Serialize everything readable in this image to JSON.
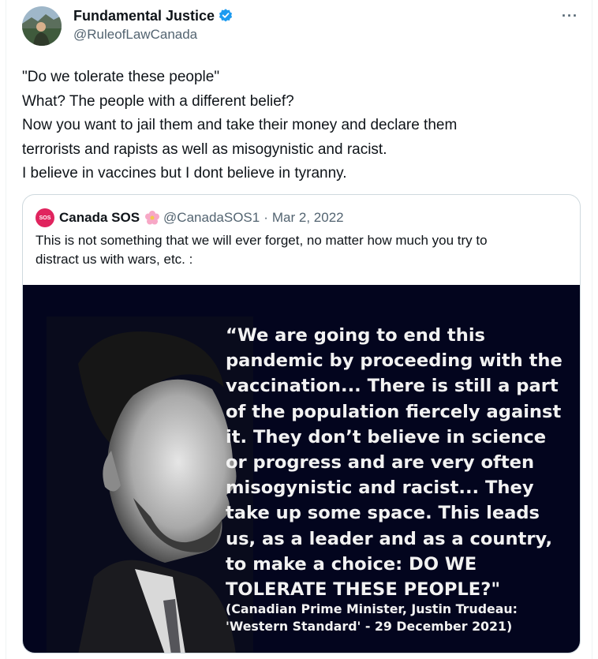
{
  "tweet": {
    "author_name": "Fundamental Justice",
    "author_handle": "@RuleofLawCanada",
    "more_label": "···",
    "text_lines": [
      "\"Do we tolerate these people\"",
      "What? The people with a different belief?",
      "Now you want to jail them and take their money and declare them",
      "terrorists and rapists as well as misogynistic and racist.",
      "I believe in vaccines but I dont believe in tyranny."
    ]
  },
  "quoted_tweet": {
    "avatar_text": "SOS",
    "author_name": "Canada SOS",
    "author_handle": "@CanadaSOS1",
    "separator": "·",
    "date": "Mar 2, 2022",
    "text_lines": [
      "This is not something that we will ever forget, no matter how much you try to",
      "distract us with wars, etc. :"
    ],
    "image": {
      "quote_lines": [
        "“We are going to end this",
        "pandemic by proceeding with the",
        "vaccination... There is still a part",
        "of the population fiercely against",
        "it. They don’t believe in science",
        "or progress and are very often",
        "misogynistic and racist... They",
        "take up some space. This leads",
        "us, as a leader and as a country,",
        "to make a choice: DO WE",
        "TOLERATE THESE PEOPLE?\""
      ],
      "attribution_lines": [
        "(Canadian Prime Minister, Justin Trudeau:",
        "'Western Standard' - 29 December 2021)"
      ]
    }
  },
  "colors": {
    "verified_badge": "#1d9bf0",
    "secondary_text": "#536471",
    "quote_border": "#cfd9de",
    "image_background": "#03051e"
  }
}
